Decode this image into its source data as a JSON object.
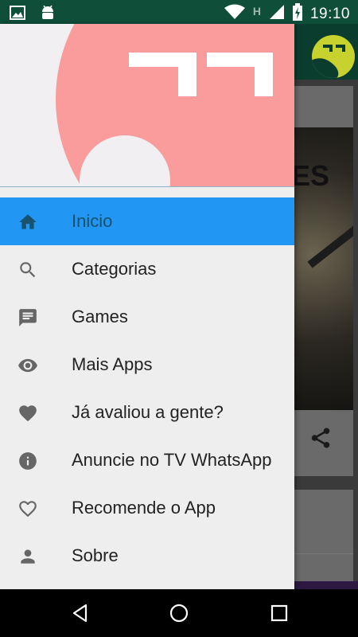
{
  "status_bar": {
    "time": "19:10",
    "network_letter": "H",
    "icons": [
      "image-icon",
      "android-icon",
      "wifi-icon",
      "signal-icon",
      "battery-charging-icon"
    ]
  },
  "drawer": {
    "header_logo": "brand-logo",
    "menu": [
      {
        "label": "Inicio",
        "icon": "home-icon",
        "active": true
      },
      {
        "label": "Categorias",
        "icon": "search-icon",
        "active": false
      },
      {
        "label": "Games",
        "icon": "chat-icon",
        "active": false
      },
      {
        "label": "Mais Apps",
        "icon": "eye-icon",
        "active": false
      },
      {
        "label": "Já avaliou a gente?",
        "icon": "heart-filled-icon",
        "active": false
      },
      {
        "label": "Anuncie no TV WhatsApp",
        "icon": "info-icon",
        "active": false
      },
      {
        "label": "Recomende o App",
        "icon": "heart-outline-icon",
        "active": false
      },
      {
        "label": "Sobre",
        "icon": "person-icon",
        "active": false
      }
    ]
  },
  "background": {
    "image_text": "ES",
    "share_icon": "share-icon"
  },
  "nav_bar": {
    "buttons": [
      "back-icon",
      "home-circle-icon",
      "recents-icon"
    ]
  },
  "colors": {
    "status_bar": "#0f4f3a",
    "header_circle": "#f99c9b",
    "active_item": "#2196f3",
    "icon_gray": "#666666",
    "active_icon": "#19526f"
  }
}
